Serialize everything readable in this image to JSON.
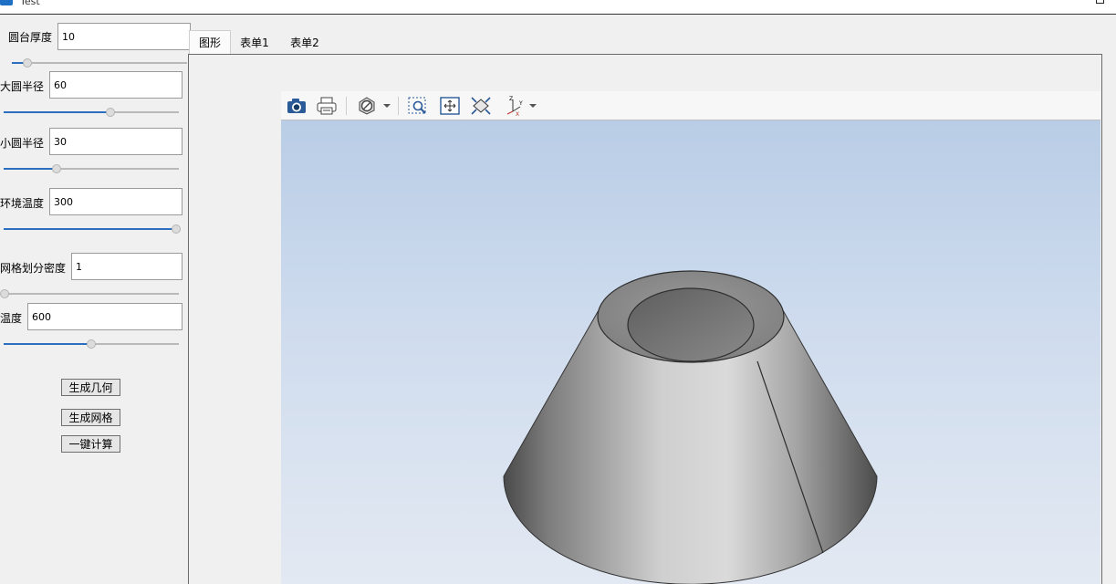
{
  "window": {
    "title": "Test"
  },
  "params": [
    {
      "label": "圆台厚度",
      "value": "10",
      "slider": 0.09
    },
    {
      "label": "大圆半径",
      "value": "60",
      "slider": 0.61
    },
    {
      "label": "小圆半径",
      "value": "30",
      "slider": 0.3
    },
    {
      "label": "环境温度",
      "value": "300",
      "slider": 1.0
    },
    {
      "label": "网格划分密度",
      "value": "1",
      "slider": 0.0
    },
    {
      "label": "温度",
      "value": "600",
      "slider": 0.5
    }
  ],
  "buttons": {
    "generate_geometry": "生成几何",
    "generate_mesh": "生成网格",
    "compute": "一键计算"
  },
  "tabs": [
    {
      "label": "图形",
      "active": true
    },
    {
      "label": "表单1",
      "active": false
    },
    {
      "label": "表单2",
      "active": false
    }
  ],
  "toolbar": {
    "icons": [
      "camera-icon",
      "print-icon",
      "display-mode-icon",
      "zoom-box-icon",
      "fit-all-icon",
      "iso-view-icon",
      "axes-view-icon"
    ]
  },
  "colors": {
    "accent": "#2c6ebf",
    "viewport_top": "#b9cde6",
    "viewport_bottom": "#e3e9f2",
    "model_gray": "#8a8a8a"
  }
}
